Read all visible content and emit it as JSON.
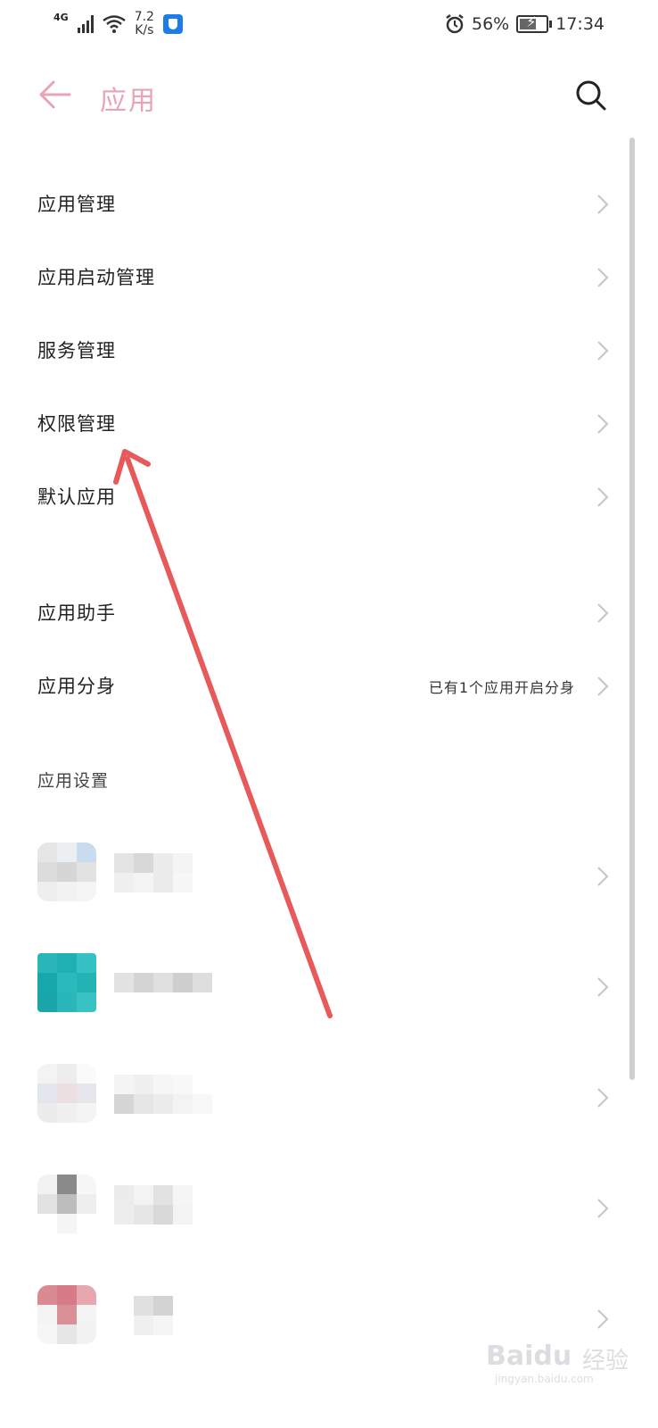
{
  "status_bar": {
    "network": "4G",
    "speed_value": "7.2",
    "speed_unit": "K/s",
    "battery": "56%",
    "time": "17:34"
  },
  "header": {
    "title": "应用"
  },
  "menu": [
    {
      "label": "应用管理",
      "value": ""
    },
    {
      "label": "应用启动管理",
      "value": ""
    },
    {
      "label": "服务管理",
      "value": ""
    },
    {
      "label": "权限管理",
      "value": ""
    },
    {
      "label": "默认应用",
      "value": ""
    },
    {
      "label": "应用助手",
      "value": ""
    },
    {
      "label": "应用分身",
      "value": "已有1个应用开启分身"
    }
  ],
  "section": {
    "app_settings": "应用设置"
  },
  "icons": {
    "back": "back-arrow-icon",
    "search": "search-icon",
    "chevron": "chevron-right-icon",
    "alarm": "alarm-icon",
    "wifi": "wifi-icon",
    "signal": "signal-icon",
    "shield": "shield-icon",
    "battery": "battery-icon"
  },
  "colors": {
    "accent": "#e8a4b4",
    "annotation_arrow": "#e65a5a"
  },
  "watermark": {
    "brand": "Baidu",
    "brand_cn": "经验",
    "url": "jingyan.baidu.com"
  }
}
